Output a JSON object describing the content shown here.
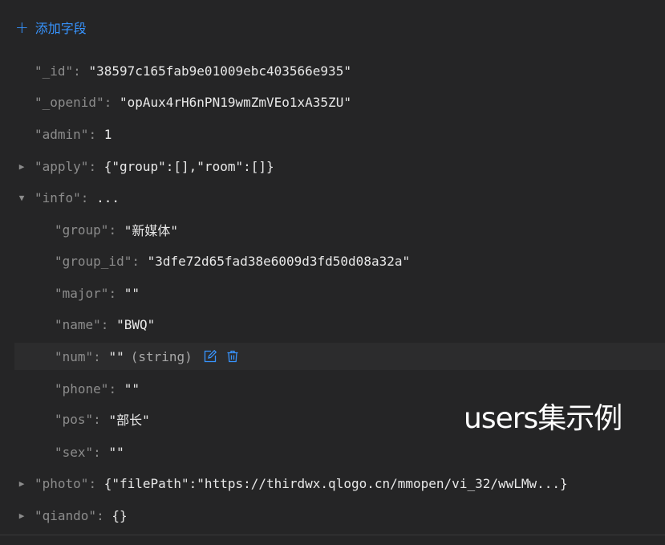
{
  "toolbar": {
    "add_field_label": "添加字段"
  },
  "fields": {
    "id": {
      "key": "\"_id\"",
      "value": "\"38597c165fab9e01009ebc403566e935\""
    },
    "openid": {
      "key": "\"_openid\"",
      "value": "\"opAux4rH6nPN19wmZmVEo1xA35ZU\""
    },
    "admin": {
      "key": "\"admin\"",
      "value": "1"
    },
    "apply": {
      "key": "\"apply\"",
      "value": "{\"group\":[],\"room\":[]}"
    },
    "info": {
      "key": "\"info\"",
      "value": "...",
      "children": {
        "group": {
          "key": "\"group\"",
          "value": "\"新媒体\""
        },
        "group_id": {
          "key": "\"group_id\"",
          "value": "\"3dfe72d65fad38e6009d3fd50d08a32a\""
        },
        "major": {
          "key": "\"major\"",
          "value": "\"\""
        },
        "name": {
          "key": "\"name\"",
          "value": "\"BWQ\""
        },
        "num": {
          "key": "\"num\"",
          "value": "\"\"",
          "type": "(string)"
        },
        "phone": {
          "key": "\"phone\"",
          "value": "\"\""
        },
        "pos": {
          "key": "\"pos\"",
          "value": "\"部长\""
        },
        "sex": {
          "key": "\"sex\"",
          "value": "\"\""
        }
      }
    },
    "photo": {
      "key": "\"photo\"",
      "value": "{\"filePath\":\"https://thirdwx.qlogo.cn/mmopen/vi_32/wwLMw...}"
    },
    "qiandao": {
      "key": "\"qiando\"",
      "value": "{}"
    }
  },
  "overlay_caption": "users集示例",
  "icons": {
    "add": "plus-icon",
    "edit": "edit-icon",
    "delete": "trash-icon",
    "expand": "caret-right-icon",
    "collapse": "caret-down-icon"
  },
  "colors": {
    "accent": "#3794ff",
    "background": "#252526",
    "key": "#8c8c8c",
    "value": "#e8e8e8"
  }
}
